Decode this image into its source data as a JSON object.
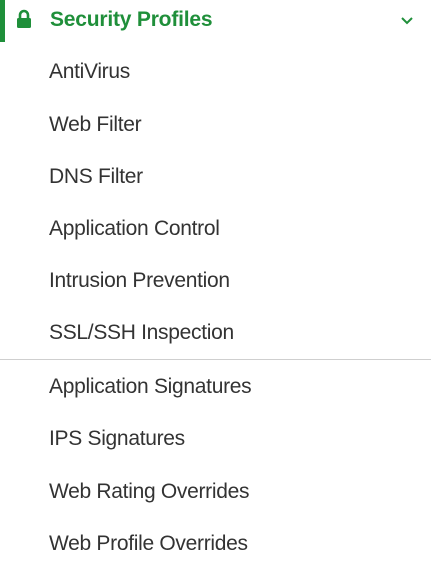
{
  "section": {
    "title": "Security Profiles",
    "icon": "lock-icon",
    "toggle_icon": "chevron-down-icon",
    "accent_color": "#1f8f3a",
    "items": [
      {
        "label": "AntiVirus"
      },
      {
        "label": "Web Filter"
      },
      {
        "label": "DNS Filter"
      },
      {
        "label": "Application Control"
      },
      {
        "label": "Intrusion Prevention"
      },
      {
        "label": "SSL/SSH Inspection"
      }
    ],
    "items_after_divider": [
      {
        "label": "Application Signatures"
      },
      {
        "label": "IPS Signatures"
      },
      {
        "label": "Web Rating Overrides"
      },
      {
        "label": "Web Profile Overrides"
      }
    ]
  }
}
